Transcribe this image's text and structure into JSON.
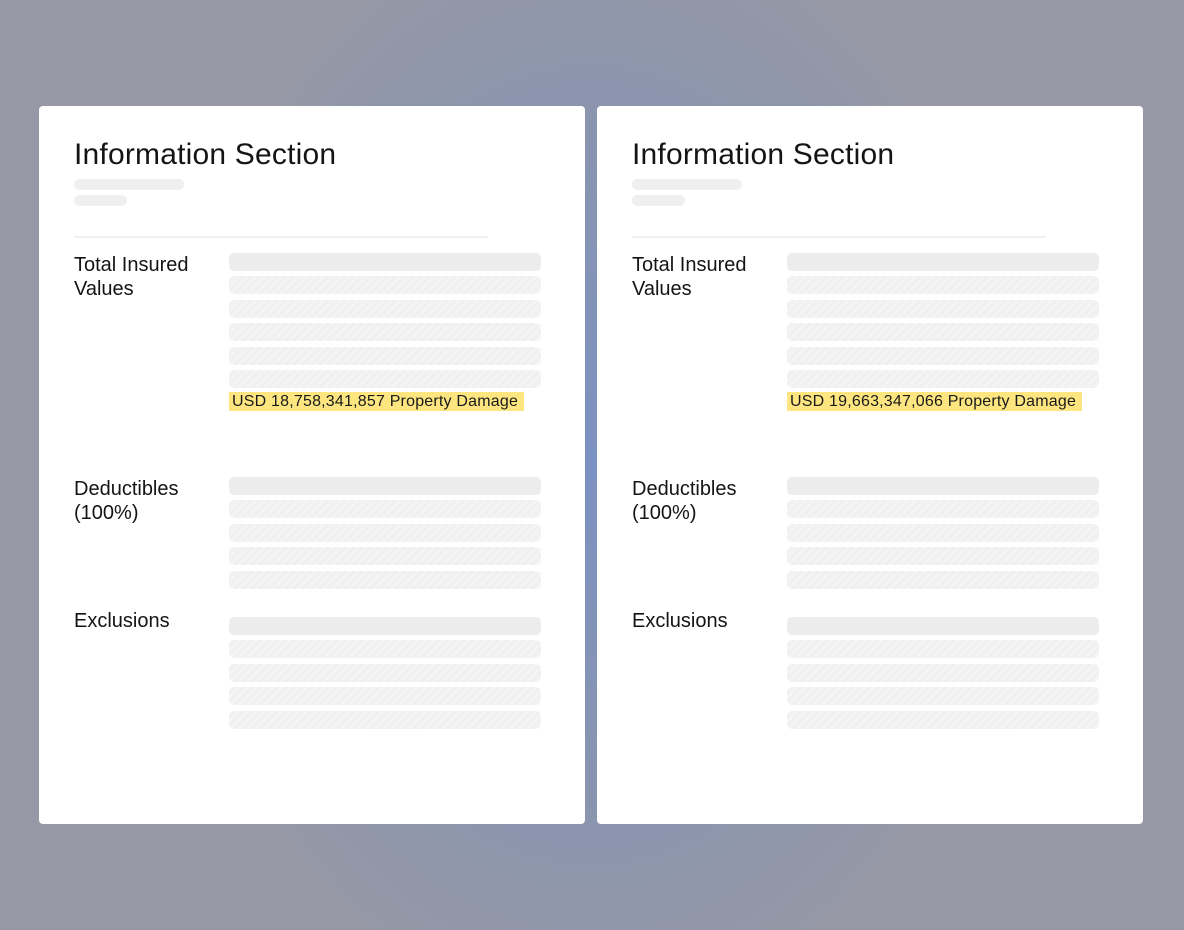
{
  "documents": [
    {
      "title": "Information Section",
      "sections": {
        "tiv_label": "Total Insured Values",
        "tiv_value": "USD 18,758,341,857 Property Damage",
        "deductibles_label": "Deductibles (100%)",
        "exclusions_label": "Exclusions"
      }
    },
    {
      "title": "Information Section",
      "sections": {
        "tiv_label": "Total Insured Values",
        "tiv_value": "USD 19,663,347,066 Property Damage",
        "deductibles_label": "Deductibles (100%)",
        "exclusions_label": "Exclusions"
      }
    }
  ],
  "colors": {
    "background": "#8894b0",
    "card": "#ffffff",
    "highlight": "#fde680",
    "skeleton": "#efefef",
    "text": "#141414"
  }
}
